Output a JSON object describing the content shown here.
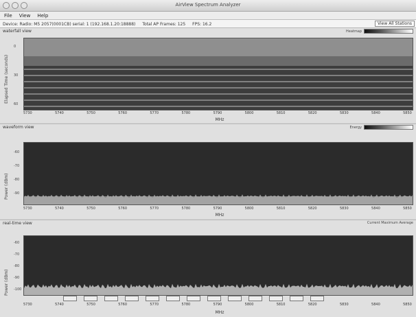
{
  "window": {
    "title": "AirView Spectrum Analyzer"
  },
  "menu": [
    "File",
    "View",
    "Help"
  ],
  "info": {
    "device": "Device: Radio: M5 2057(0001CB) serial: 1 (192.168.1.20:18888)",
    "total": "Total AP Frames: 125",
    "fps": "FPS: 16.2",
    "right_button": "View All Stations"
  },
  "panels": {
    "waterfall": {
      "title": "waterfall view",
      "ylabel": "Elapsed Time (seconds)",
      "yticks": [
        "0",
        "30",
        "60"
      ],
      "xlabel": "MHz",
      "legend": "Heatmap"
    },
    "waveform": {
      "title": "waveform view",
      "ylabel": "Power (dBm)",
      "yticks": [
        "-60",
        "-70",
        "-80",
        "-90"
      ],
      "xlabel": "MHz",
      "legend": "Energy"
    },
    "realtime": {
      "title": "real-time view",
      "ylabel": "Power (dBm)",
      "yticks": [
        "-60",
        "-70",
        "-80",
        "-90",
        "-100"
      ],
      "xlabel": "MHz",
      "legend": "Current  Maximum  Average"
    }
  },
  "x_ticks": [
    "5730",
    "5740",
    "5750",
    "5760",
    "5770",
    "5780",
    "5790",
    "5800",
    "5810",
    "5820",
    "5830",
    "5840",
    "5850"
  ]
}
